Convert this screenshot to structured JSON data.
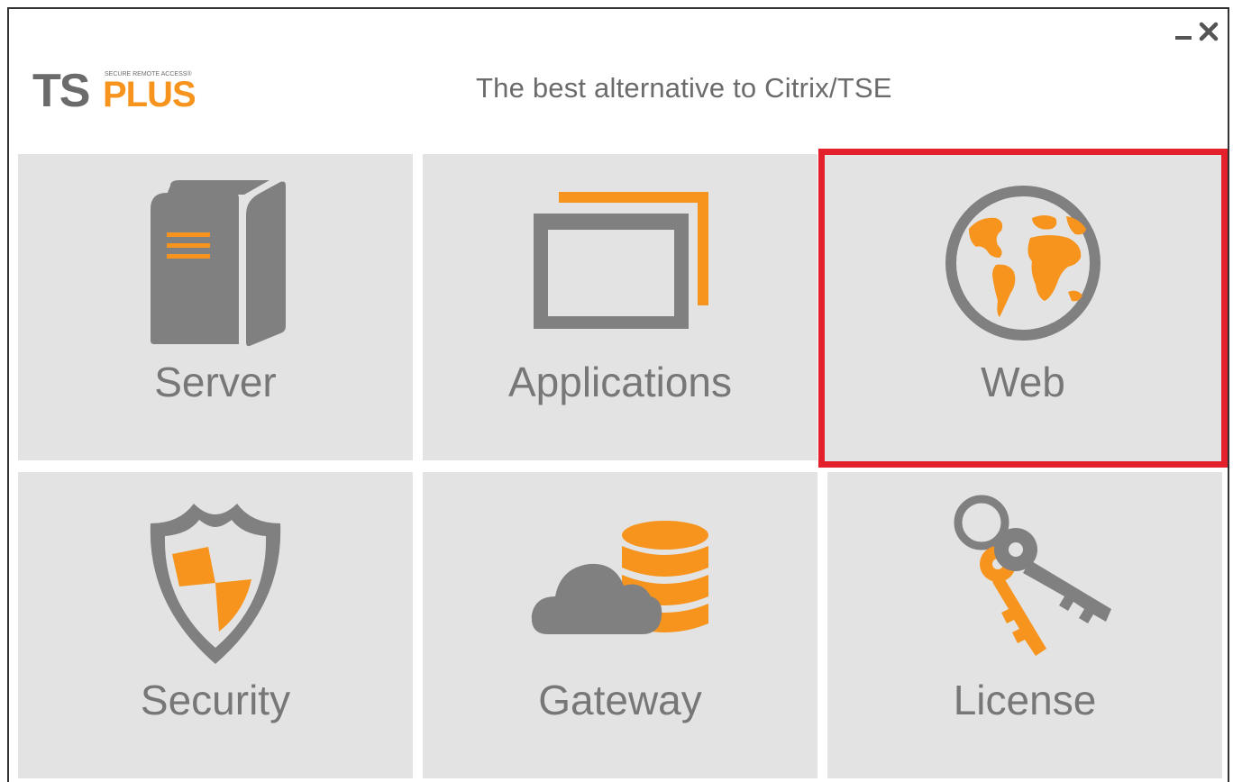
{
  "window": {
    "minimize_label": "minimize",
    "close_label": "close"
  },
  "header": {
    "logo_text": "TSPLUS",
    "logo_subtext": "SECURE REMOTE ACCESS®",
    "tagline": "The best alternative to Citrix/TSE"
  },
  "tiles": [
    {
      "label": "Server",
      "icon": "server-icon"
    },
    {
      "label": "Applications",
      "icon": "applications-icon"
    },
    {
      "label": "Web",
      "icon": "globe-icon",
      "highlighted": true
    },
    {
      "label": "Security",
      "icon": "shield-icon"
    },
    {
      "label": "Gateway",
      "icon": "cloud-database-icon"
    },
    {
      "label": "License",
      "icon": "keys-icon"
    }
  ],
  "colors": {
    "accent": "#f7941d",
    "icon_gray": "#808080",
    "tile_bg": "#e3e3e3",
    "highlight": "#e3202b",
    "label": "#777777"
  }
}
